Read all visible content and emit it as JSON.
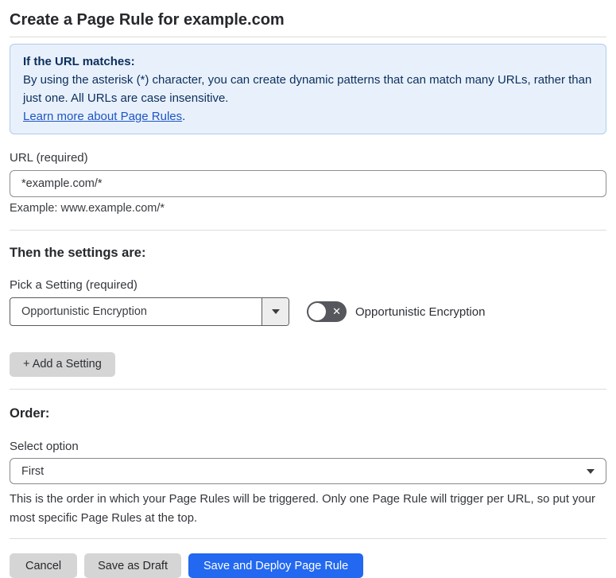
{
  "page": {
    "title": "Create a Page Rule for example.com"
  },
  "info_box": {
    "heading": "If the URL matches:",
    "body": "By using the asterisk (*) character, you can create dynamic patterns that can match many URLs, rather than just one. All URLs are case insensitive.",
    "link_label": "Learn more about Page Rules",
    "link_suffix": "."
  },
  "url_field": {
    "label": "URL (required)",
    "value": "*example.com/*",
    "hint": "Example: www.example.com/*"
  },
  "settings_section": {
    "heading": "Then the settings are:",
    "picker_label": "Pick a Setting (required)",
    "picker_value": "Opportunistic Encryption",
    "toggle_label": "Opportunistic Encryption",
    "toggle_state": "off",
    "toggle_off_glyph": "✕",
    "add_button_label": "+ Add a Setting"
  },
  "order_section": {
    "heading": "Order:",
    "select_label": "Select option",
    "select_value": "First",
    "description": "This is the order in which your Page Rules will be triggered. Only one Page Rule will trigger per URL, so put your most specific Page Rules at the top."
  },
  "footer": {
    "cancel_label": "Cancel",
    "save_draft_label": "Save as Draft",
    "save_deploy_label": "Save and Deploy Page Rule"
  },
  "colors": {
    "primary_button_blue": "#2268f0",
    "info_box_background": "#e8f1fb",
    "info_box_border": "#afccec",
    "info_text_navy": "#0c2e5e",
    "link_blue": "#1f54c5",
    "toggle_off_gray": "#55575d",
    "secondary_button_gray": "#d5d5d5"
  }
}
